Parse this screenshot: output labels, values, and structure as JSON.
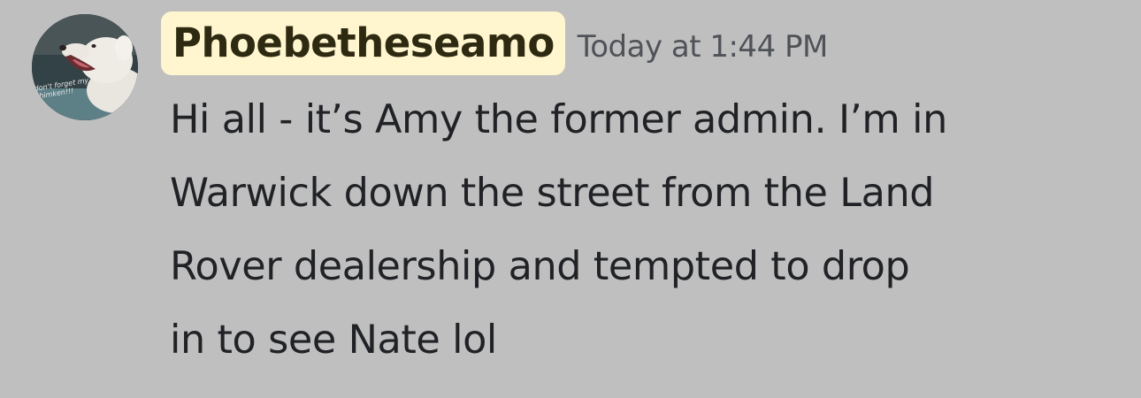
{
  "message": {
    "author": {
      "username": "Phoebetheseamo",
      "avatar_icon": "dog-avatar-icon",
      "avatar_caption": "don't forget my chimken!!!"
    },
    "timestamp": "Today at 1:44 PM",
    "content_lines": [
      "Hi all - it’s Amy the former admin. I’m in",
      "Warwick down the street from the Land",
      "Rover dealership and tempted to drop",
      "in to see Nate lol"
    ]
  },
  "colors": {
    "background": "#bfbfbf",
    "username_highlight": "#fff6cf",
    "username_text": "#2e2a12",
    "timestamp_text": "#4f5358",
    "content_text": "#202226"
  }
}
